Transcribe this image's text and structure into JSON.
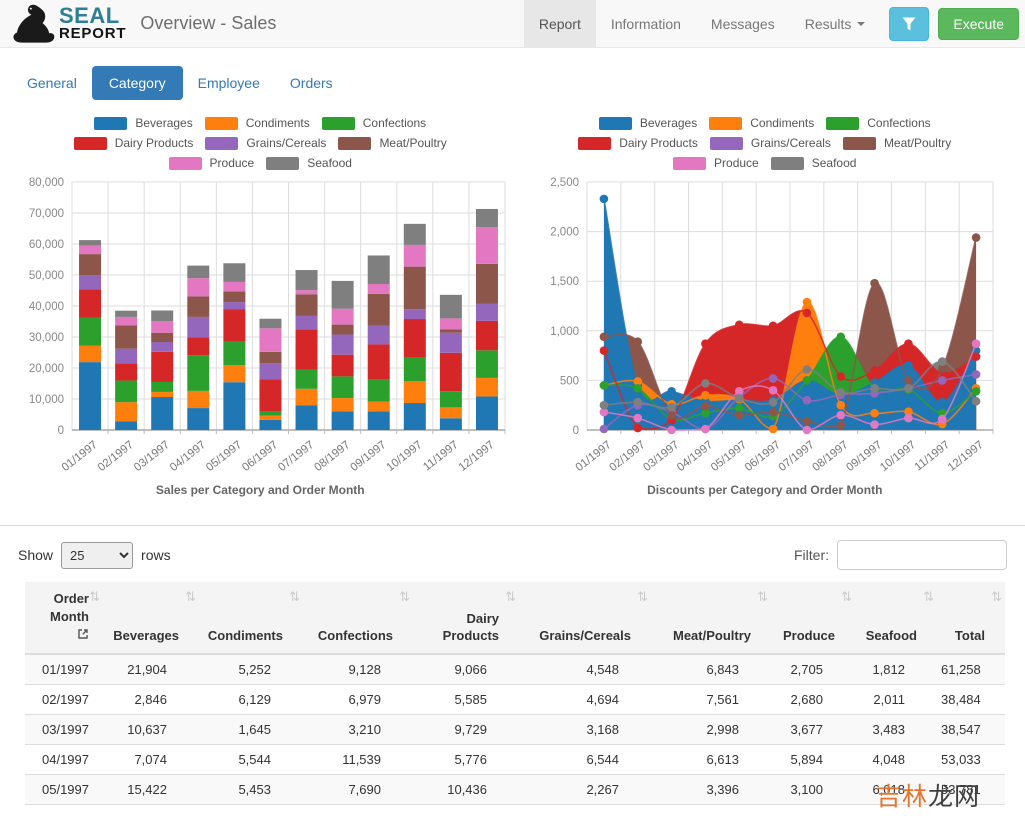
{
  "header": {
    "logo_line1": "SEAL",
    "logo_line2": "REPORT",
    "title": "Overview - Sales",
    "nav": [
      {
        "label": "Report",
        "active": true
      },
      {
        "label": "Information",
        "active": false
      },
      {
        "label": "Messages",
        "active": false
      },
      {
        "label": "Results",
        "active": false,
        "has_caret": true
      }
    ],
    "execute_label": "Execute"
  },
  "tabs": {
    "items": [
      {
        "label": "General",
        "active": false
      },
      {
        "label": "Category",
        "active": true
      },
      {
        "label": "Employee",
        "active": false
      },
      {
        "label": "Orders",
        "active": false
      }
    ]
  },
  "chart_data": [
    {
      "type": "bar",
      "stacked": true,
      "title": "Sales per Category and Order Month",
      "categories": [
        "01/1997",
        "02/1997",
        "03/1997",
        "04/1997",
        "05/1997",
        "06/1997",
        "07/1997",
        "08/1997",
        "09/1997",
        "10/1997",
        "11/1997",
        "12/1997"
      ],
      "ylim": [
        0,
        80000
      ],
      "ytick": 10000,
      "grid": true,
      "legend_position": "top",
      "series": [
        {
          "name": "Beverages",
          "color": "#1f77b4",
          "values": [
            21904,
            2846,
            10637,
            7074,
            15422,
            3300,
            7900,
            6000,
            6000,
            8700,
            3800,
            10800
          ]
        },
        {
          "name": "Condiments",
          "color": "#ff7f0e",
          "values": [
            5252,
            6129,
            1645,
            5544,
            5453,
            1300,
            5400,
            4300,
            3200,
            7000,
            3500,
            6000
          ]
        },
        {
          "name": "Confections",
          "color": "#2ca02c",
          "values": [
            9128,
            6979,
            3210,
            11539,
            7690,
            1400,
            6200,
            7000,
            7000,
            7600,
            5200,
            8900
          ]
        },
        {
          "name": "Dairy Products",
          "color": "#d62728",
          "values": [
            9066,
            5585,
            9729,
            5776,
            10436,
            10300,
            13000,
            7000,
            11400,
            12500,
            12400,
            9500
          ]
        },
        {
          "name": "Grains/Cereals",
          "color": "#9467bd",
          "values": [
            4548,
            4694,
            3168,
            6544,
            2267,
            5200,
            4300,
            6500,
            6000,
            3200,
            6500,
            5600
          ]
        },
        {
          "name": "Meat/Poultry",
          "color": "#8c564b",
          "values": [
            6843,
            7561,
            2998,
            6613,
            3396,
            3700,
            7000,
            3200,
            10300,
            13700,
            1100,
            12800
          ]
        },
        {
          "name": "Produce",
          "color": "#e377c2",
          "values": [
            2705,
            2680,
            3677,
            5894,
            3100,
            7600,
            1300,
            5100,
            3200,
            7000,
            3500,
            11800
          ]
        },
        {
          "name": "Seafood",
          "color": "#7f7f7f",
          "values": [
            1812,
            2011,
            3483,
            4048,
            6018,
            3100,
            6500,
            9000,
            9200,
            6800,
            7600,
            5900
          ]
        }
      ]
    },
    {
      "type": "area",
      "title": "Discounts per Category and Order Month",
      "categories": [
        "01/1997",
        "02/1997",
        "03/1997",
        "04/1997",
        "05/1997",
        "06/1997",
        "07/1997",
        "08/1997",
        "09/1997",
        "10/1997",
        "11/1997",
        "12/1997"
      ],
      "ylim": [
        0,
        2500
      ],
      "ytick": 500,
      "grid": true,
      "legend_position": "top",
      "fill_order": [
        "Produce",
        "Grains/Cereals",
        "Seafood",
        "Meat/Poultry",
        "Dairy Products",
        "Condiments",
        "Confections",
        "Beverages"
      ],
      "series": [
        {
          "name": "Beverages",
          "color": "#1f77b4",
          "values": [
            2330,
            450,
            390,
            290,
            300,
            300,
            500,
            350,
            480,
            650,
            280,
            800
          ]
        },
        {
          "name": "Condiments",
          "color": "#ff7f0e",
          "values": [
            450,
            490,
            260,
            350,
            310,
            10,
            1290,
            250,
            170,
            185,
            60,
            420
          ]
        },
        {
          "name": "Confections",
          "color": "#2ca02c",
          "values": [
            450,
            420,
            110,
            170,
            220,
            140,
            500,
            940,
            420,
            410,
            170,
            390
          ]
        },
        {
          "name": "Dairy Products",
          "color": "#d62728",
          "values": [
            800,
            20,
            100,
            870,
            1060,
            1050,
            1180,
            540,
            600,
            870,
            570,
            740
          ]
        },
        {
          "name": "Grains/Cereals",
          "color": "#9467bd",
          "values": [
            10,
            250,
            180,
            10,
            330,
            520,
            300,
            355,
            370,
            420,
            500,
            560
          ]
        },
        {
          "name": "Meat/Poultry",
          "color": "#8c564b",
          "values": [
            940,
            890,
            150,
            240,
            150,
            180,
            90,
            50,
            1480,
            500,
            620,
            1940
          ]
        },
        {
          "name": "Produce",
          "color": "#e377c2",
          "values": [
            180,
            120,
            0,
            10,
            390,
            400,
            0,
            150,
            55,
            120,
            110,
            870
          ]
        },
        {
          "name": "Seafood",
          "color": "#7f7f7f",
          "values": [
            250,
            280,
            230,
            470,
            320,
            280,
            610,
            380,
            420,
            420,
            690,
            290
          ]
        }
      ]
    }
  ],
  "table_controls": {
    "show_label": "Show",
    "rows_value": "25",
    "rows_suffix": "rows",
    "filter_label": "Filter:",
    "filter_value": ""
  },
  "table": {
    "columns": [
      "Order Month",
      "Beverages",
      "Condiments",
      "Confections",
      "Dairy Products",
      "Grains/Cereals",
      "Meat/Poultry",
      "Produce",
      "Seafood",
      "Total"
    ],
    "rows": [
      [
        "01/1997",
        "21,904",
        "5,252",
        "9,128",
        "9,066",
        "4,548",
        "6,843",
        "2,705",
        "1,812",
        "61,258"
      ],
      [
        "02/1997",
        "2,846",
        "6,129",
        "6,979",
        "5,585",
        "4,694",
        "7,561",
        "2,680",
        "2,011",
        "38,484"
      ],
      [
        "03/1997",
        "10,637",
        "1,645",
        "3,210",
        "9,729",
        "3,168",
        "2,998",
        "3,677",
        "3,483",
        "38,547"
      ],
      [
        "04/1997",
        "7,074",
        "5,544",
        "11,539",
        "5,776",
        "6,544",
        "6,613",
        "5,894",
        "4,048",
        "53,033"
      ],
      [
        "05/1997",
        "15,422",
        "5,453",
        "7,690",
        "10,436",
        "2,267",
        "3,396",
        "3,100",
        "6,018",
        "53,781"
      ]
    ]
  },
  "watermark": {
    "part1": "吉林",
    "part2": "龙网",
    "color1": "#e5742f",
    "color2": "#3f3f3f"
  }
}
